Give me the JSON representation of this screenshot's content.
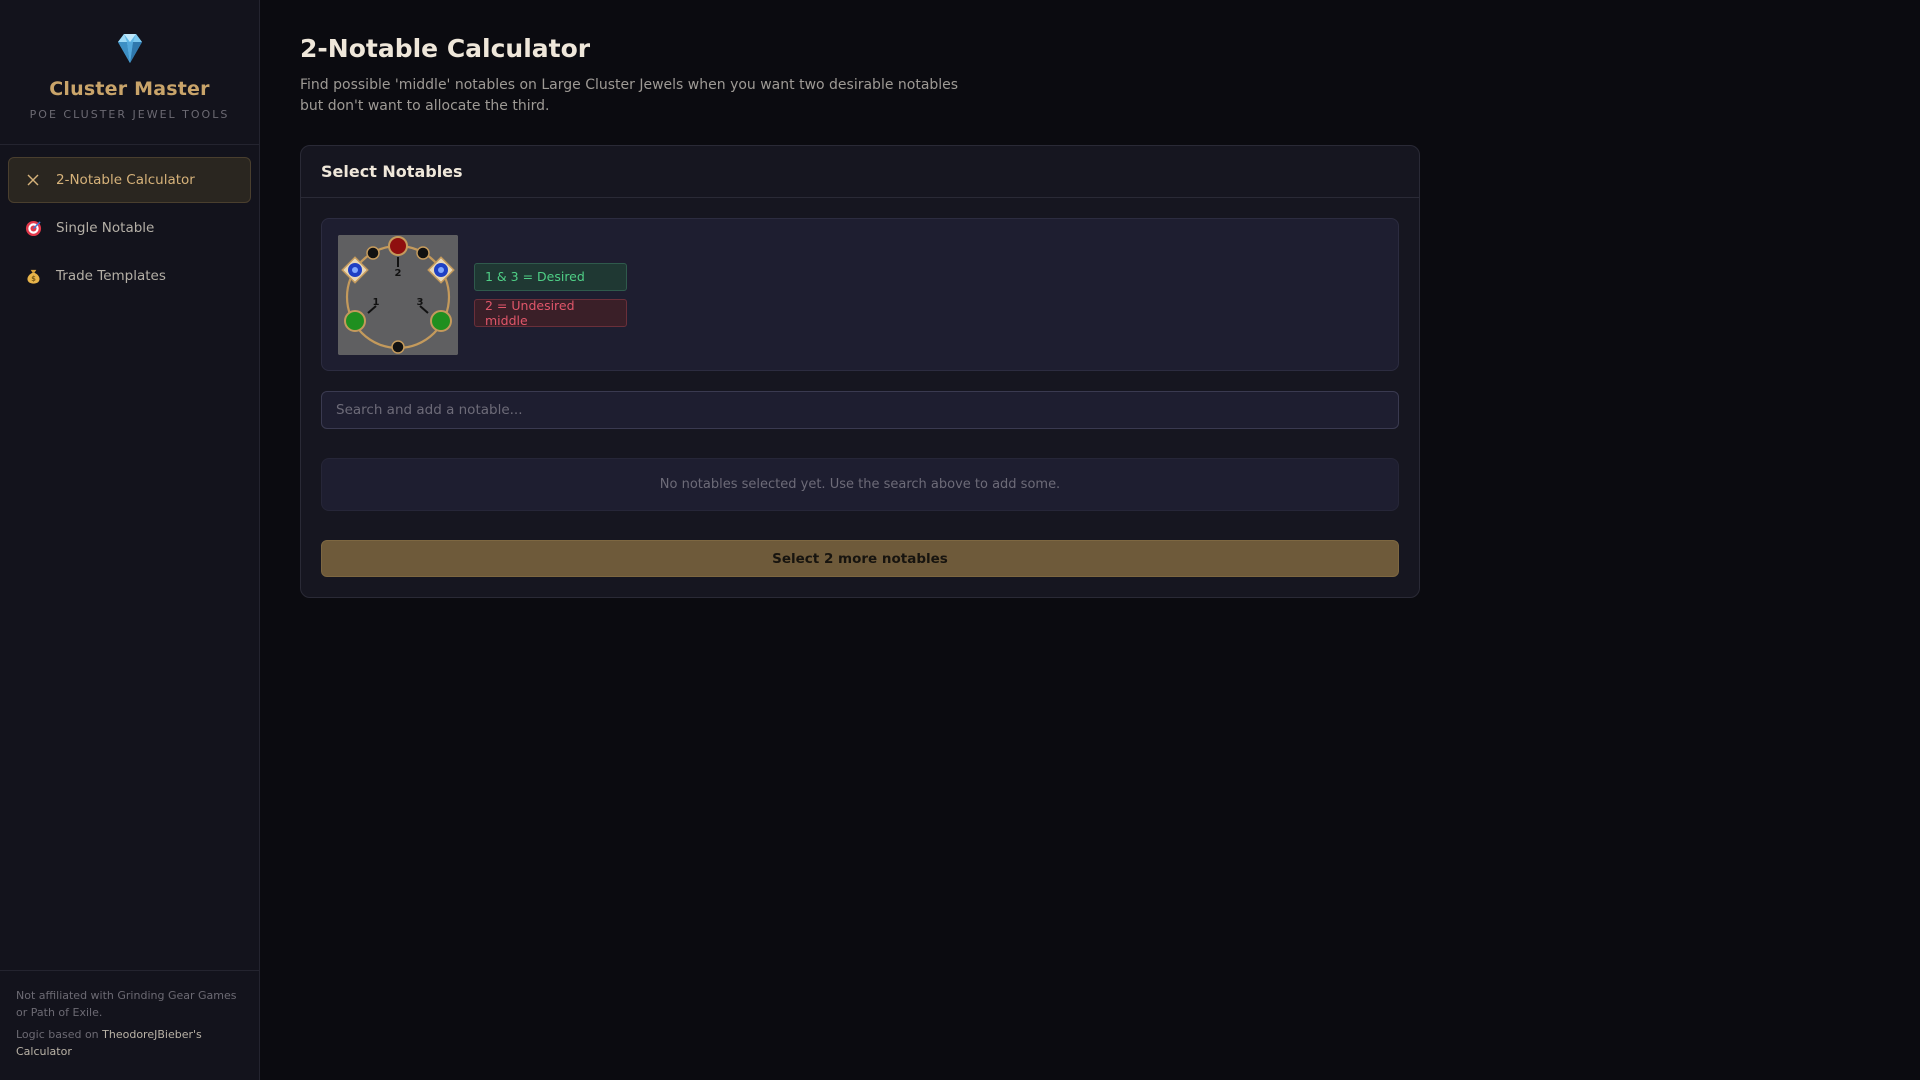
{
  "brand": {
    "icon": "gem-icon",
    "title": "Cluster Master",
    "subtitle": "POE CLUSTER JEWEL TOOLS"
  },
  "sidebar": {
    "items": [
      {
        "label": "2-Notable Calculator",
        "icon": "crossed-swords-icon",
        "active": true
      },
      {
        "label": "Single Notable",
        "icon": "target-icon",
        "active": false
      },
      {
        "label": "Trade Templates",
        "icon": "money-bag-icon",
        "active": false
      }
    ],
    "footer": {
      "disclaimer": "Not affiliated with Grinding Gear Games or Path of Exile.",
      "credit_prefix": "Logic based on ",
      "credit_link": "TheodoreJBieber's Calculator"
    }
  },
  "main": {
    "title": "2-Notable Calculator",
    "description": "Find possible 'middle' notables on Large Cluster Jewels when you want two desirable notables but don't want to allocate the third."
  },
  "card": {
    "title": "Select Notables",
    "diagram": {
      "labels": [
        "1",
        "2",
        "3"
      ]
    },
    "legend": {
      "desired": "1 & 3 = Desired",
      "undesired": "2 = Undesired middle"
    },
    "search": {
      "placeholder": "Search and add a notable..."
    },
    "empty_message": "No notables selected yet. Use the search above to add some.",
    "submit_label": "Select 2 more notables"
  },
  "colors": {
    "accent": "#c9a46a",
    "desired": "#4fcf86",
    "undesired": "#e0566a",
    "button": "#6e5a3a"
  }
}
